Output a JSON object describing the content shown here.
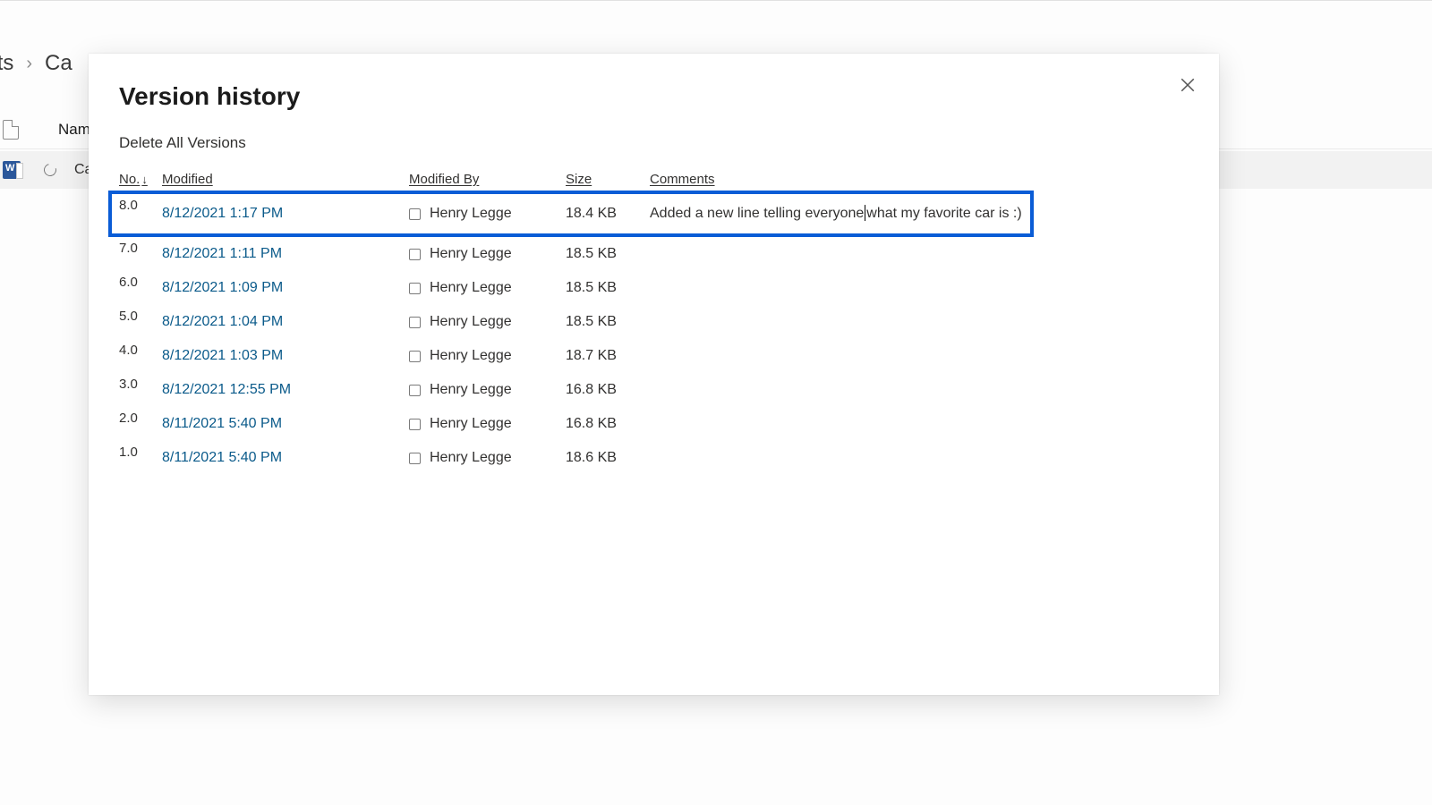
{
  "background": {
    "breadcrumb_prev_partial": "ents",
    "breadcrumb_current_partial": "Ca",
    "name_column": "Name",
    "file_name_partial": "Car typ"
  },
  "modal": {
    "title": "Version history",
    "delete_all": "Delete All Versions",
    "columns": {
      "no": "No.",
      "modified": "Modified",
      "modified_by": "Modified By",
      "size": "Size",
      "comments": "Comments"
    },
    "versions": [
      {
        "no": "8.0",
        "modified": "8/12/2021 1:17 PM",
        "modified_by": "Henry Legge",
        "size": "18.4 KB",
        "comment_a": "Added a new line telling everyone",
        "comment_b": "what my favorite car is :)",
        "highlight": true
      },
      {
        "no": "7.0",
        "modified": "8/12/2021 1:11 PM",
        "modified_by": "Henry Legge",
        "size": "18.5 KB"
      },
      {
        "no": "6.0",
        "modified": "8/12/2021 1:09 PM",
        "modified_by": "Henry Legge",
        "size": "18.5 KB"
      },
      {
        "no": "5.0",
        "modified": "8/12/2021 1:04 PM",
        "modified_by": "Henry Legge",
        "size": "18.5 KB"
      },
      {
        "no": "4.0",
        "modified": "8/12/2021 1:03 PM",
        "modified_by": "Henry Legge",
        "size": "18.7 KB"
      },
      {
        "no": "3.0",
        "modified": "8/12/2021 12:55 PM",
        "modified_by": "Henry Legge",
        "size": "16.8 KB"
      },
      {
        "no": "2.0",
        "modified": "8/11/2021 5:40 PM",
        "modified_by": "Henry Legge",
        "size": "16.8 KB"
      },
      {
        "no": "1.0",
        "modified": "8/11/2021 5:40 PM",
        "modified_by": "Henry Legge",
        "size": "18.6 KB"
      }
    ]
  }
}
